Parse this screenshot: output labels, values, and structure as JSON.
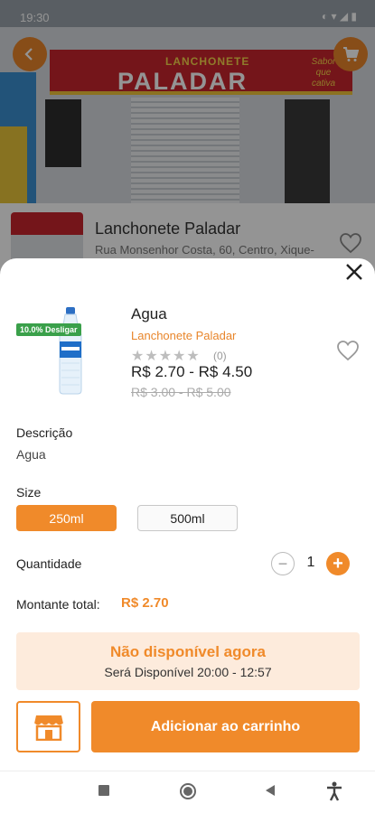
{
  "status_bar": {
    "time": "19:30",
    "icons_text": "◐ ▾ ◢ ▮"
  },
  "hero": {
    "sign_small": "LANCHONETE",
    "sign_big": "PALADAR",
    "sign_tagline": "Sabor que cativa"
  },
  "store": {
    "name": "Lanchonete Paladar",
    "address": "Rua Monsenhor Costa, 60, Centro, Xique-"
  },
  "product": {
    "discount_badge": "10.0% Desligar",
    "title": "Agua",
    "store_name": "Lanchonete Paladar",
    "stars": "★★★★★",
    "reviews": "(0)",
    "price_range": "R$ 2.70 - R$ 4.50",
    "old_price_range": "R$ 3.00 - R$ 5.00"
  },
  "description": {
    "label": "Descrição",
    "text": "Agua"
  },
  "size": {
    "label": "Size",
    "options": [
      "250ml",
      "500ml"
    ],
    "selected": "250ml"
  },
  "quantity": {
    "label": "Quantidade",
    "value": "1",
    "minus": "−",
    "plus": "+"
  },
  "total": {
    "label": "Montante total:",
    "amount": "R$ 2.70"
  },
  "availability": {
    "title": "Não disponível agora",
    "subtitle": "Será Disponível 20:00 - 12:57"
  },
  "actions": {
    "add_to_cart": "Adicionar ao carrinho"
  },
  "colors": {
    "accent": "#f08a2a",
    "discount": "#3aa04a",
    "unavailable_bg": "#fdebdc"
  },
  "icons": {
    "back": "chevron-left-icon",
    "cart": "cart-icon",
    "favorite": "heart-outline-icon",
    "close": "close-icon",
    "store": "storefront-icon",
    "nav": [
      "square-nav-icon",
      "home-circle-icon",
      "back-triangle-icon",
      "accessibility-icon"
    ]
  }
}
